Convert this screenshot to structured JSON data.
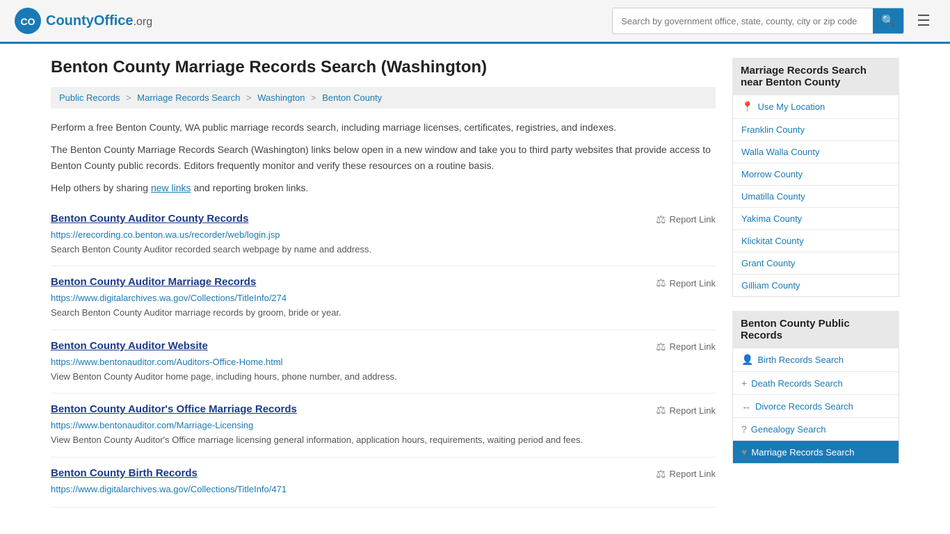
{
  "header": {
    "logo_text": "CountyOffice",
    "logo_suffix": ".org",
    "search_placeholder": "Search by government office, state, county, city or zip code",
    "search_value": ""
  },
  "breadcrumb": {
    "items": [
      {
        "label": "Public Records",
        "href": "#"
      },
      {
        "label": "Marriage Records Search",
        "href": "#"
      },
      {
        "label": "Washington",
        "href": "#"
      },
      {
        "label": "Benton County",
        "href": "#"
      }
    ]
  },
  "page": {
    "title": "Benton County Marriage Records Search (Washington)",
    "desc1": "Perform a free Benton County, WA public marriage records search, including marriage licenses, certificates, registries, and indexes.",
    "desc2": "The Benton County Marriage Records Search (Washington) links below open in a new window and take you to third party websites that provide access to Benton County public records. Editors frequently monitor and verify these resources on a routine basis.",
    "desc3_pre": "Help others by sharing ",
    "desc3_link": "new links",
    "desc3_post": " and reporting broken links."
  },
  "records": [
    {
      "title": "Benton County Auditor County Records",
      "url": "https://erecording.co.benton.wa.us/recorder/web/login.jsp",
      "desc": "Search Benton County Auditor recorded search webpage by name and address.",
      "report": "Report Link"
    },
    {
      "title": "Benton County Auditor Marriage Records",
      "url": "https://www.digitalarchives.wa.gov/Collections/TitleInfo/274",
      "desc": "Search Benton County Auditor marriage records by groom, bride or year.",
      "report": "Report Link"
    },
    {
      "title": "Benton County Auditor Website",
      "url": "https://www.bentonauditor.com/Auditors-Office-Home.html",
      "desc": "View Benton County Auditor home page, including hours, phone number, and address.",
      "report": "Report Link"
    },
    {
      "title": "Benton County Auditor's Office Marriage Records",
      "url": "https://www.bentonauditor.com/Marriage-Licensing",
      "desc": "View Benton County Auditor's Office marriage licensing general information, application hours, requirements, waiting period and fees.",
      "report": "Report Link"
    },
    {
      "title": "Benton County Birth Records",
      "url": "https://www.digitalarchives.wa.gov/Collections/TitleInfo/471",
      "desc": "",
      "report": "Report Link"
    }
  ],
  "sidebar": {
    "nearby_heading": "Marriage Records Search near Benton County",
    "nearby_items": [
      {
        "label": "Use My Location",
        "icon": "📍",
        "href": "#"
      },
      {
        "label": "Franklin County",
        "href": "#"
      },
      {
        "label": "Walla Walla County",
        "href": "#"
      },
      {
        "label": "Morrow County",
        "href": "#"
      },
      {
        "label": "Umatilla County",
        "href": "#"
      },
      {
        "label": "Yakima County",
        "href": "#"
      },
      {
        "label": "Klickitat County",
        "href": "#"
      },
      {
        "label": "Grant County",
        "href": "#"
      },
      {
        "label": "Gilliam County",
        "href": "#"
      }
    ],
    "public_heading": "Benton County Public Records",
    "public_items": [
      {
        "label": "Birth Records Search",
        "icon": "👤",
        "href": "#"
      },
      {
        "label": "Death Records Search",
        "icon": "+",
        "href": "#"
      },
      {
        "label": "Divorce Records Search",
        "icon": "↔",
        "href": "#"
      },
      {
        "label": "Genealogy Search",
        "icon": "?",
        "href": "#"
      },
      {
        "label": "Marriage Records Search",
        "icon": "♥",
        "href": "#",
        "active": true
      }
    ]
  }
}
